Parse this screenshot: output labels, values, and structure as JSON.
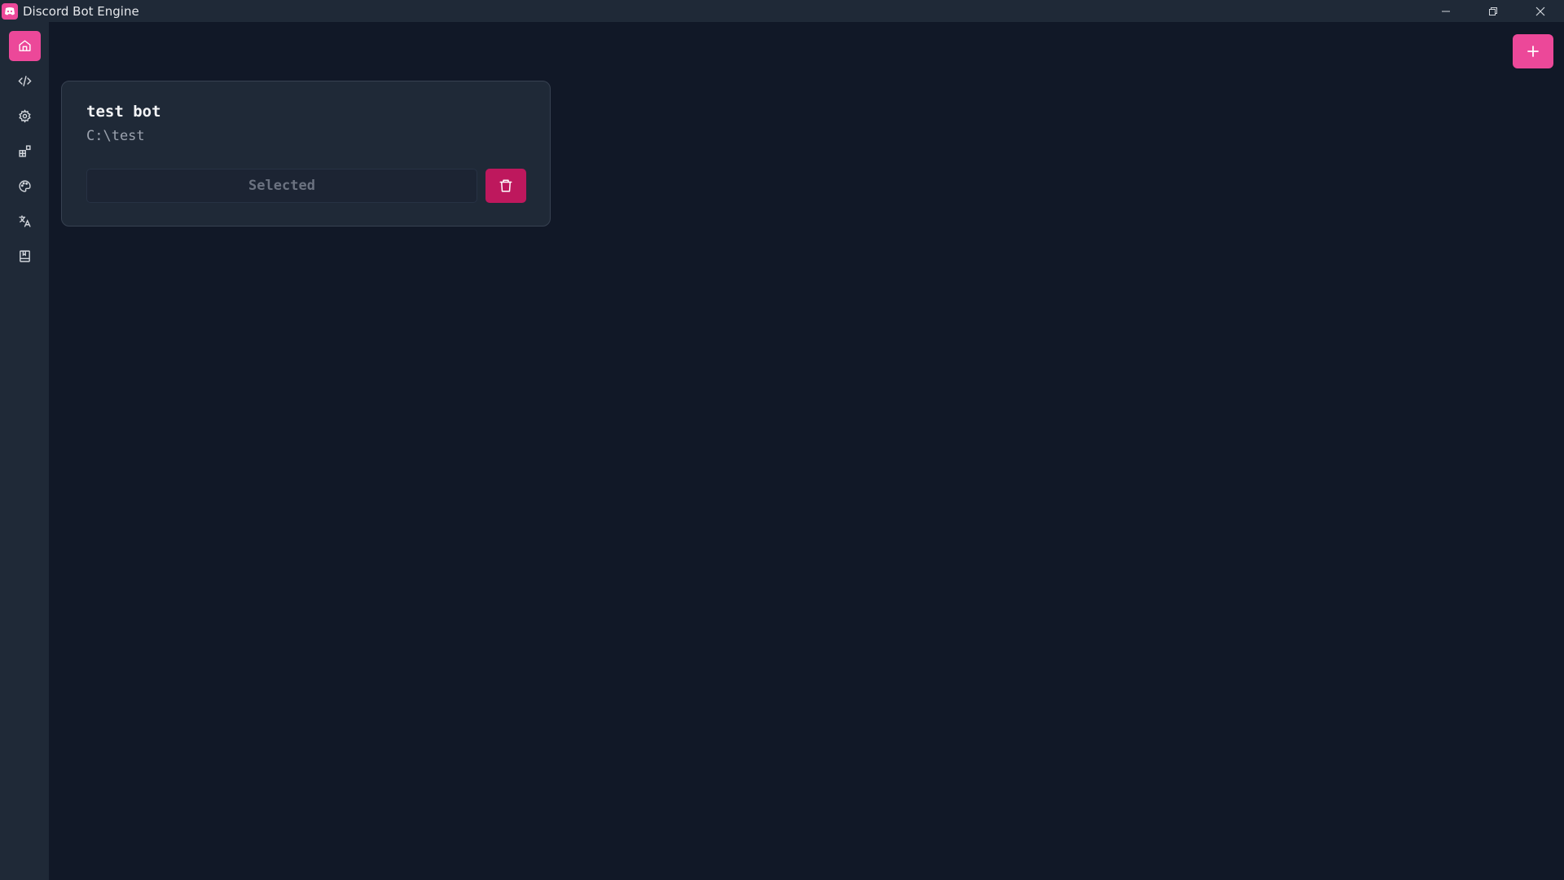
{
  "window": {
    "title": "Discord Bot Engine",
    "app_icon": "discord-icon",
    "controls": [
      "minimize-icon",
      "restore-icon",
      "close-icon"
    ]
  },
  "sidebar": {
    "items": [
      {
        "icon": "home-icon",
        "active": true
      },
      {
        "icon": "code-icon",
        "active": false
      },
      {
        "icon": "gear-icon",
        "active": false
      },
      {
        "icon": "extensions-icon",
        "active": false
      },
      {
        "icon": "palette-icon",
        "active": false
      },
      {
        "icon": "translate-icon",
        "active": false
      },
      {
        "icon": "book-icon",
        "active": false
      }
    ]
  },
  "toolbar": {
    "add_icon": "plus-icon"
  },
  "projects": [
    {
      "name": "test bot",
      "path": "C:\\test",
      "status_label": "Selected",
      "delete_icon": "trash-icon"
    }
  ],
  "colors": {
    "accent": "#ec4899",
    "danger": "#be185d",
    "background": "#111827",
    "surface": "#1f2937"
  }
}
